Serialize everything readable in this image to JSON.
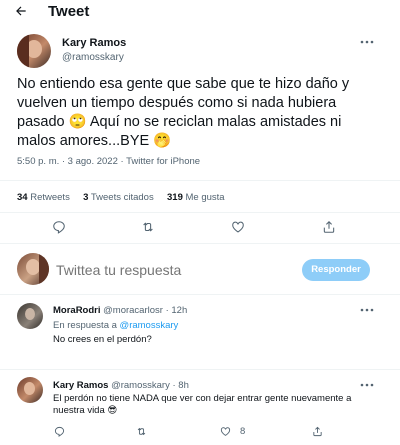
{
  "header": {
    "title": "Tweet"
  },
  "colors": {
    "accent": "#1d9bf0",
    "muted": "#536471",
    "text": "#0f1419",
    "divider": "#eff3f4",
    "reply_button_bg": "#8ecdf8"
  },
  "tweet": {
    "name": "Kary Ramos",
    "handle": "@ramosskary",
    "text": "No entiendo esa gente que sabe que te hizo daño y vuelven un tiempo después como si nada hubiera pasado 🙄 Aquí no se reciclan malas amistades ni malos amores...BYE 🤭",
    "time": "5:50 p. m. · 3 ago. 2022 · Twitter for iPhone",
    "stats": {
      "retweets_count": "34",
      "retweets_label": "Retweets",
      "quotes_count": "3",
      "quotes_label": "Tweets citados",
      "likes_count": "319",
      "likes_label": "Me gusta"
    }
  },
  "composer": {
    "placeholder": "Twittea tu respuesta",
    "button": "Responder"
  },
  "replies": [
    {
      "name": "MoraRodri",
      "handle": "@moracarlosr",
      "sep": "·",
      "time": "12h",
      "in_reply_prefix": "En respuesta a",
      "in_reply_handle": "@ramosskary",
      "text": "No crees en el perdón?"
    },
    {
      "name": "Kary Ramos",
      "handle": "@ramosskary",
      "sep": "·",
      "time": "8h",
      "text": "El perdón no tiene NADA que ver con dejar entrar gente nuevamente a nuestra vida 😎",
      "likes": "8"
    }
  ]
}
